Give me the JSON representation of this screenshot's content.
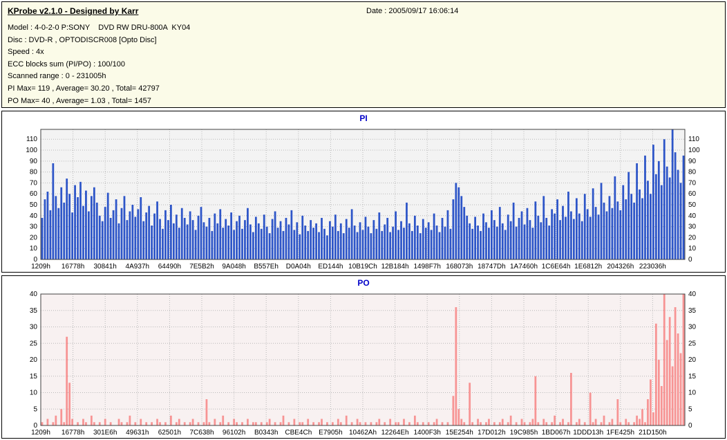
{
  "header": {
    "title": "KProbe v2.1.0 - Designed by Karr",
    "date": "Date : 2005/09/17 16:06:14",
    "info_lines": [
      "Model : 4-0-2-0 P:SONY    DVD RW DRU-800A  KY04",
      "Disc : DVD-R , OPTODISCR008 [Opto Disc]",
      "Speed : 4x",
      "ECC blocks sum (PI/PO) : 100/100",
      "Scanned range : 0 - 231005h",
      "PI Max= 119 , Average= 30.20 , Total= 42797",
      "PO Max= 40 , Average= 1.03 , Total= 1457"
    ]
  },
  "chart_data": [
    {
      "type": "bar",
      "title": "PI",
      "color": "#2d55c8",
      "plot_bg": "#f3f3f3",
      "ylim": [
        0,
        119
      ],
      "ytick_step": 10,
      "ytick_max": 110,
      "grid": true,
      "stats": {
        "max": 119,
        "average": 30.2,
        "total": 42797
      },
      "x_labels": [
        "1209h",
        "16778h",
        "30841h",
        "4A937h",
        "64490h",
        "7E5B2h",
        "9A048h",
        "B557Eh",
        "D0A04h",
        "ED144h",
        "10B19Ch",
        "12B184h",
        "1498F7h",
        "168073h",
        "18747Dh",
        "1A7460h",
        "1C6E64h",
        "1E6812h",
        "204326h",
        "223036h"
      ],
      "values": [
        38,
        55,
        62,
        45,
        88,
        58,
        47,
        66,
        52,
        74,
        60,
        43,
        68,
        57,
        71,
        49,
        63,
        44,
        58,
        66,
        52,
        40,
        35,
        48,
        61,
        38,
        45,
        55,
        33,
        47,
        58,
        36,
        44,
        50,
        39,
        46,
        57,
        35,
        43,
        49,
        31,
        42,
        53,
        37,
        28,
        45,
        36,
        50,
        33,
        41,
        29,
        47,
        38,
        32,
        44,
        36,
        27,
        40,
        48,
        34,
        30,
        38,
        26,
        42,
        33,
        46,
        29,
        37,
        31,
        43,
        27,
        35,
        40,
        28,
        36,
        47,
        32,
        25,
        39,
        33,
        28,
        41,
        30,
        24,
        37,
        44,
        29,
        35,
        26,
        38,
        32,
        45,
        27,
        34,
        23,
        40,
        31,
        26,
        36,
        29,
        33,
        25,
        38,
        28,
        22,
        35,
        30,
        41,
        26,
        33,
        24,
        37,
        29,
        46,
        31,
        25,
        34,
        27,
        39,
        30,
        24,
        36,
        28,
        43,
        26,
        32,
        38,
        25,
        30,
        44,
        27,
        35,
        29,
        52,
        33,
        26,
        40,
        31,
        24,
        37,
        29,
        34,
        27,
        42,
        31,
        25,
        38,
        30,
        45,
        28,
        55,
        70,
        66,
        58,
        48,
        40,
        33,
        28,
        39,
        31,
        26,
        42,
        34,
        29,
        45,
        36,
        30,
        48,
        33,
        27,
        41,
        35,
        52,
        30,
        38,
        44,
        32,
        47,
        36,
        29,
        53,
        40,
        34,
        58,
        38,
        31,
        46,
        42,
        55,
        36,
        49,
        39,
        62,
        44,
        37,
        56,
        42,
        35,
        60,
        46,
        39,
        65,
        48,
        41,
        70,
        52,
        44,
        58,
        47,
        76,
        53,
        45,
        68,
        55,
        80,
        60,
        52,
        88,
        64,
        56,
        95,
        72,
        60,
        105,
        78,
        90,
        68,
        110,
        85,
        75,
        119,
        98,
        82,
        70,
        95
      ]
    },
    {
      "type": "bar",
      "title": "PO",
      "color": "#f79494",
      "plot_bg": "#f8f1f1",
      "ylim": [
        0,
        40
      ],
      "ytick_step": 5,
      "ytick_max": 40,
      "grid": true,
      "stats": {
        "max": 40,
        "average": 1.03,
        "total": 1457
      },
      "x_labels": [
        "1209h",
        "16778h",
        "301E6h",
        "49631h",
        "62501h",
        "7C638h",
        "96102h",
        "B0343h",
        "CBE4Ch",
        "E7905h",
        "10462Ah",
        "12264Eh",
        "1400F3h",
        "15E254h",
        "17D012h",
        "19C985h",
        "1BD067h",
        "1DDD13h",
        "1FE425h",
        "21D150h"
      ],
      "values": [
        1,
        0,
        2,
        0,
        1,
        3,
        0,
        5,
        1,
        27,
        13,
        2,
        0,
        1,
        0,
        2,
        1,
        0,
        3,
        1,
        0,
        1,
        0,
        2,
        0,
        1,
        0,
        0,
        2,
        1,
        0,
        1,
        3,
        0,
        1,
        0,
        2,
        0,
        1,
        0,
        1,
        0,
        2,
        1,
        0,
        1,
        0,
        3,
        0,
        1,
        2,
        0,
        1,
        0,
        1,
        2,
        0,
        1,
        0,
        1,
        8,
        1,
        0,
        2,
        0,
        1,
        3,
        0,
        1,
        0,
        2,
        1,
        0,
        1,
        0,
        2,
        0,
        1,
        1,
        0,
        1,
        0,
        1,
        2,
        0,
        1,
        0,
        1,
        3,
        0,
        1,
        0,
        2,
        0,
        1,
        1,
        0,
        2,
        0,
        1,
        0,
        1,
        2,
        0,
        1,
        0,
        1,
        0,
        2,
        1,
        0,
        3,
        0,
        1,
        0,
        2,
        1,
        0,
        1,
        0,
        1,
        0,
        1,
        2,
        0,
        1,
        0,
        2,
        0,
        1,
        1,
        0,
        2,
        0,
        1,
        0,
        3,
        1,
        0,
        1,
        0,
        1,
        0,
        1,
        2,
        0,
        1,
        0,
        1,
        0,
        9,
        36,
        5,
        2,
        1,
        0,
        13,
        1,
        0,
        2,
        1,
        0,
        1,
        2,
        0,
        1,
        0,
        1,
        2,
        0,
        1,
        3,
        0,
        1,
        0,
        2,
        1,
        0,
        1,
        2,
        15,
        1,
        0,
        2,
        1,
        0,
        1,
        3,
        0,
        1,
        2,
        0,
        1,
        16,
        0,
        1,
        2,
        0,
        1,
        0,
        10,
        1,
        2,
        0,
        1,
        3,
        0,
        1,
        2,
        0,
        8,
        1,
        0,
        2,
        1,
        0,
        1,
        3,
        2,
        5,
        1,
        8,
        14,
        4,
        31,
        20,
        12,
        40,
        26,
        33,
        18,
        36,
        28,
        22,
        40
      ]
    }
  ]
}
